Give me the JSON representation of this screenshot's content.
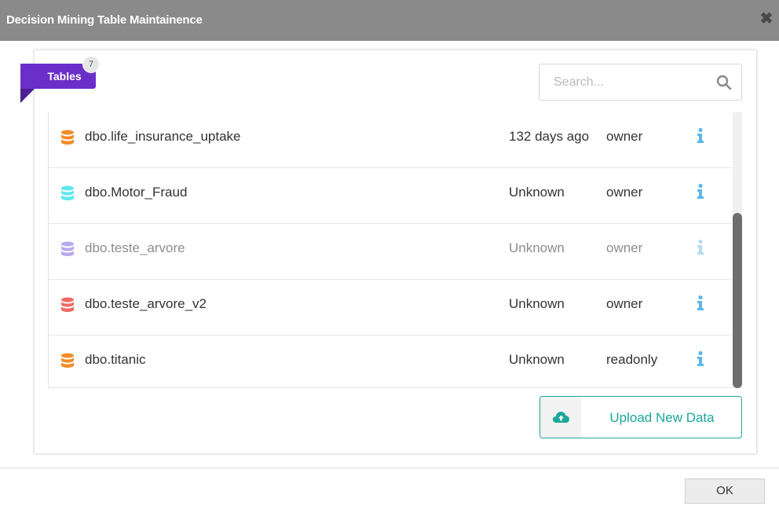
{
  "window": {
    "title": "Decision Mining Table Maintainence",
    "close_icon": "close-icon"
  },
  "tab": {
    "label": "Tables",
    "count": "7",
    "color": "#6a2fc9"
  },
  "search": {
    "placeholder": "Search...",
    "value": "",
    "icon": "search-icon"
  },
  "tables": [
    {
      "name": "dbo.life_insurance_uptake",
      "modified": "132 days ago",
      "permission": "owner",
      "icon_color": "#f28c28",
      "dimmed": false
    },
    {
      "name": "dbo.Motor_Fraud",
      "modified": "Unknown",
      "permission": "owner",
      "icon_color": "#5ee8ee",
      "dimmed": false
    },
    {
      "name": "dbo.teste_arvore",
      "modified": "Unknown",
      "permission": "owner",
      "icon_color": "#b7a8ee",
      "dimmed": true
    },
    {
      "name": "dbo.teste_arvore_v2",
      "modified": "Unknown",
      "permission": "owner",
      "icon_color": "#f06a62",
      "dimmed": false
    },
    {
      "name": "dbo.titanic",
      "modified": "Unknown",
      "permission": "readonly",
      "icon_color": "#f28c28",
      "dimmed": false
    }
  ],
  "scroll": {
    "position_fraction": 0.6
  },
  "upload": {
    "label": "Upload New Data",
    "icon": "cloud-upload-icon",
    "color": "#1ba79a"
  },
  "footer": {
    "ok_label": "OK"
  },
  "colors": {
    "info_icon": "#5ab8e8",
    "info_icon_dim": "#b5dcf2"
  }
}
